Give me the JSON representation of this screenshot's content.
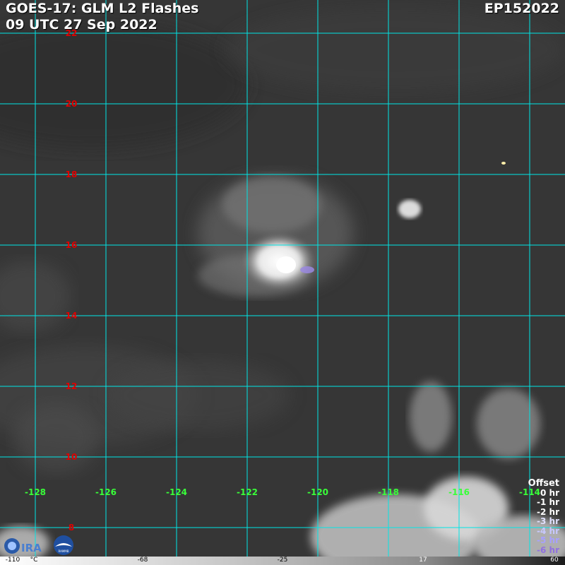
{
  "header": {
    "title_line1": "GOES-17: GLM L2 Flashes",
    "title_line2": "09 UTC 27 Sep 2022",
    "storm_id": "EP152022"
  },
  "grid": {
    "latitudes": [
      "22",
      "20",
      "18",
      "16",
      "14",
      "12",
      "10",
      "8"
    ],
    "longitudes": [
      "-128",
      "-126",
      "-124",
      "-122",
      "-120",
      "-118",
      "-116",
      "-114"
    ],
    "line_color": "#00e5e5",
    "lat_label_color": "#e00000",
    "lon_label_color": "#39ff39"
  },
  "legend": {
    "title": "Offset",
    "entries": [
      {
        "label": "0 hr",
        "color": "#ffffff"
      },
      {
        "label": "-1 hr",
        "color": "#ffffff"
      },
      {
        "label": "-2 hr",
        "color": "#ffffff"
      },
      {
        "label": "-3 hr",
        "color": "#e0e0ff"
      },
      {
        "label": "-4 hr",
        "color": "#c8c8ff"
      },
      {
        "label": "-5 hr",
        "color": "#a8a0ff"
      },
      {
        "label": "-6 hr",
        "color": "#9070e0"
      }
    ]
  },
  "colorbar": {
    "ticks": [
      "-110",
      "°C",
      "-68",
      "-25",
      "17",
      "60"
    ]
  },
  "logos": {
    "cira": "cira-logo",
    "rammb": "rammb-logo"
  }
}
